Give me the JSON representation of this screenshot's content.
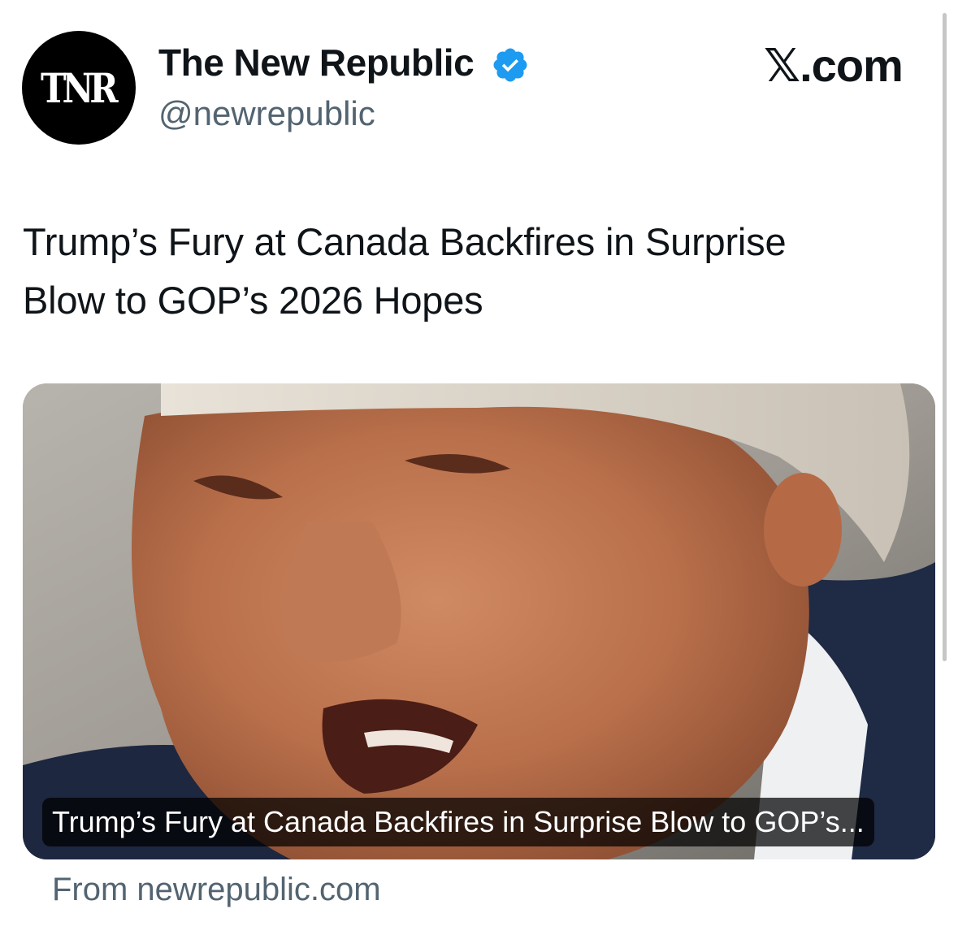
{
  "account": {
    "avatar_icon": "tnr-logo-icon",
    "avatar_text": "TNR",
    "display_name": "The New Republic",
    "verified": true,
    "verified_color": "#1d9bf0",
    "handle": "@newrepublic"
  },
  "source_brand": "𝕏.com",
  "tweet": {
    "text_line1": "Trump’s Fury at Canada Backfires in Surprise",
    "text_line2": "Blow to GOP’s 2026 Hopes"
  },
  "card": {
    "image_alt": "close-up-photo-of-man-speaking",
    "caption": "Trump’s Fury at Canada Backfires in Surprise Blow to GOP’s...",
    "source": "From newrepublic.com"
  },
  "colors": {
    "text_primary": "#0f1419",
    "text_secondary": "#536471",
    "avatar_bg": "#000000"
  }
}
